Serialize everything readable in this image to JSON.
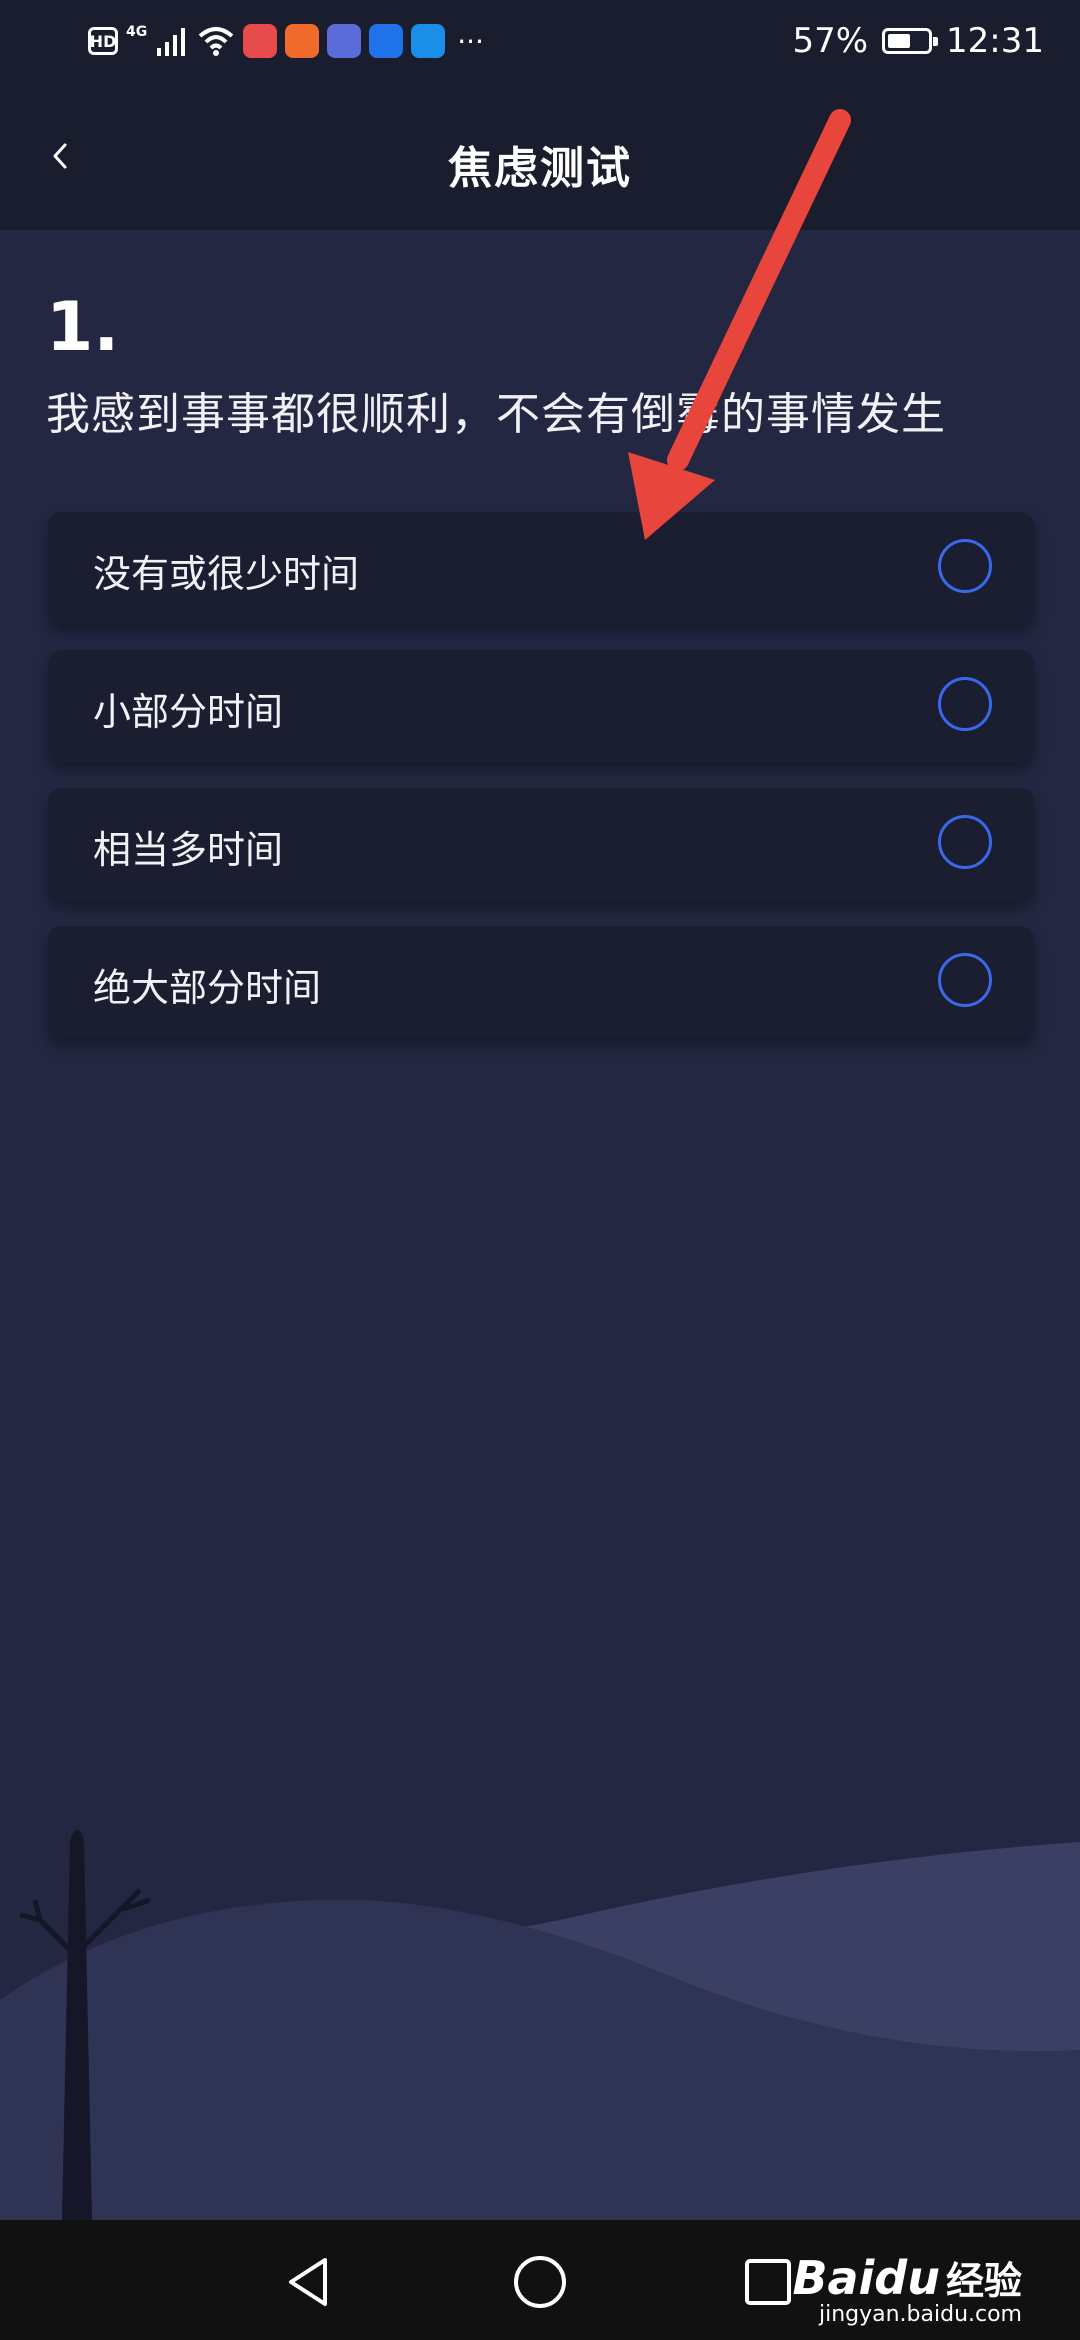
{
  "status_bar": {
    "left_badge": "HD",
    "network": "4G",
    "battery": "57%",
    "battery_level": 0.57,
    "time": "12:31",
    "app_icon_colors": [
      "#e84b4b",
      "#f06a2b",
      "#5b6bd8",
      "#1f72e8",
      "#1b8fe8"
    ]
  },
  "header": {
    "title": "焦虑测试"
  },
  "question": {
    "number": "1.",
    "text": "我感到事事都很顺利，不会有倒霉的事情发生"
  },
  "options": [
    {
      "label": "没有或很少时间"
    },
    {
      "label": "小部分时间"
    },
    {
      "label": "相当多时间"
    },
    {
      "label": "绝大部分时间"
    }
  ],
  "watermark": {
    "logo": "Baidu",
    "brand": "经验",
    "url": "jingyan.baidu.com"
  },
  "colors": {
    "background": "#232741",
    "header": "#1a1d2e",
    "option_card": "#1b1e31",
    "radio_border": "#3a68ea",
    "annotation_arrow": "#e8453c"
  }
}
